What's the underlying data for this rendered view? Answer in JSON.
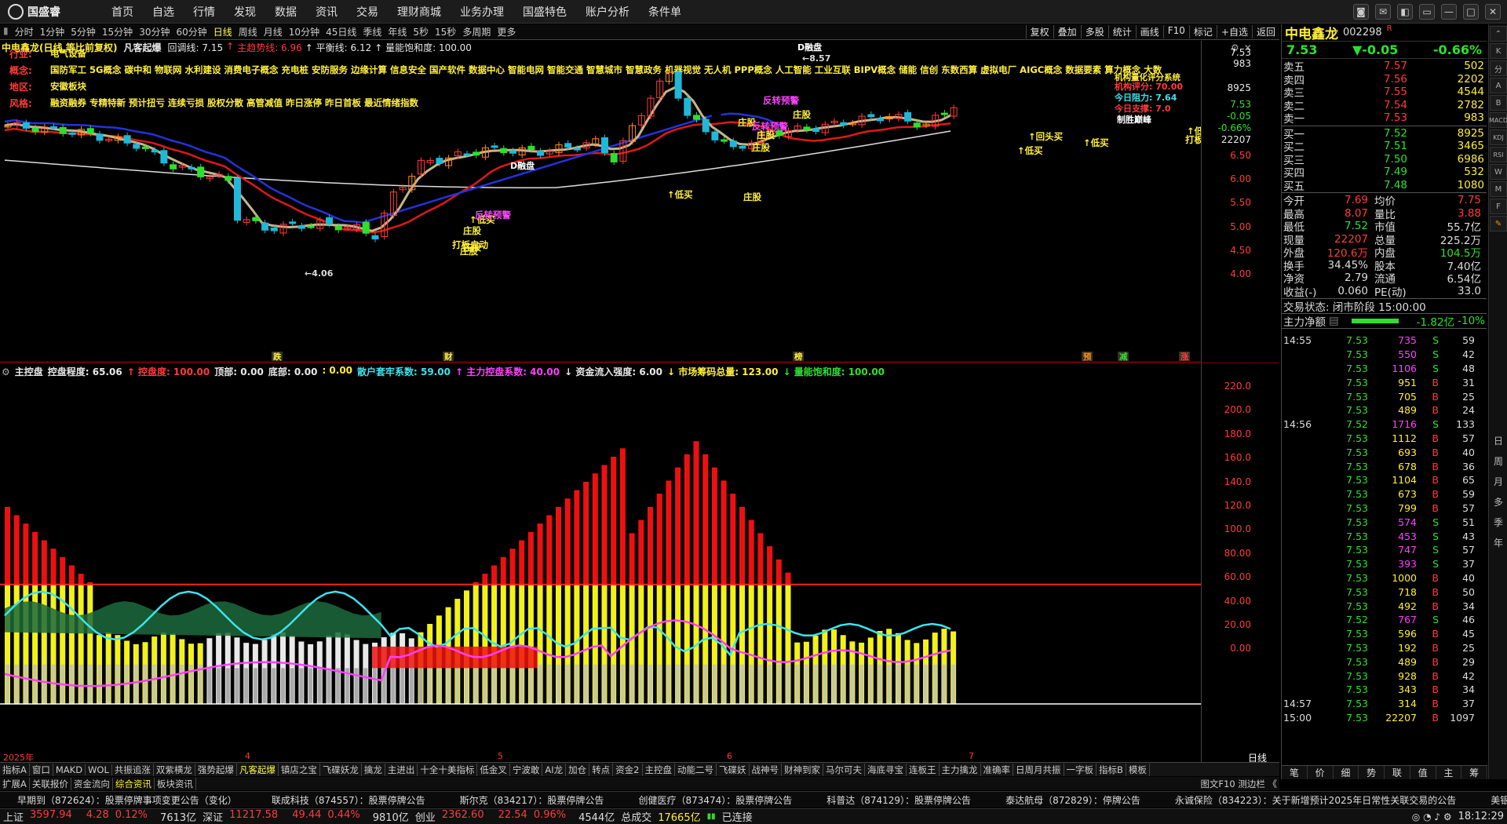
{
  "menubar": {
    "logo": "国盛睿",
    "items": [
      "首页",
      "自选",
      "行情",
      "发现",
      "数据",
      "资讯",
      "交易",
      "理财商城",
      "业务办理",
      "国盛特色",
      "账户分析",
      "条件单"
    ]
  },
  "periodbar": {
    "items": [
      "分时",
      "1分钟",
      "5分钟",
      "15分钟",
      "30分钟",
      "60分钟",
      "日线",
      "周线",
      "月线",
      "10分钟",
      "45日线",
      "季线",
      "年线",
      "5秒",
      "15秒",
      "多周期",
      "更多"
    ],
    "active": "日线",
    "tools": [
      "复权",
      "叠加",
      "多股",
      "统计",
      "画线",
      "F10",
      "标记",
      "+自选",
      "返回"
    ]
  },
  "main": {
    "title": "中电鑫龙(日线,等比前复权)",
    "indicator": "凡客起爆",
    "params": [
      {
        "text": "回调线: 7.15",
        "color": "#e8e8e8"
      },
      {
        "text": "↑ ",
        "color": "#ff3b3b"
      },
      {
        "text": "主趋势线: 6.96",
        "color": "#ff3b3b"
      },
      {
        "text": "↑ 平衡线: 6.12",
        "color": "#e8e8e8"
      },
      {
        "text": "↑ 量能饱和度: 100.00",
        "color": "#e8e8e8"
      }
    ],
    "info": [
      {
        "key": "行业:",
        "val": "电气设备"
      },
      {
        "key": "概念:",
        "val": "国防军工 5G概念 碳中和 物联网 水利建设 消费电子概念 充电桩 安防服务 边缘计算 信息安全 国产软件 数据中心 智能电网 智能交通 智慧城市 智慧政务 机器视觉 无人机 PPP概念 人工智能 工业互联 BIPV概念 储能 信创 东数西算 虚拟电厂 AIGC概念 数据要素 算力概念 大数"
      },
      {
        "key": "地区:",
        "val": "安徽板块"
      },
      {
        "key": "风格:",
        "val": "融资融券 专精特新 预计扭亏 连续亏损 股权分散 高管减值 昨日涨停 昨日首板 最近情绪指数"
      }
    ],
    "y_ticks": [
      "7.53",
      "983",
      "8925",
      "7.53",
      "-0.05",
      "-0.66%",
      "22207",
      "6.50",
      "6.00",
      "5.50",
      "5.00",
      "4.50",
      "4.00"
    ],
    "annotations": {
      "high": "8.57",
      "low": "4.06",
      "top_label": "D融盘",
      "mid_label": "D融盘",
      "box": [
        "机构评分: 70.00",
        "今日阻力: 7.64",
        "今日支撑: 7.0",
        "制胜巅峰"
      ],
      "tags": [
        "庄股",
        "庄股",
        "庄股",
        "庄股",
        "庄股",
        "庄股",
        "庄股",
        "庄股",
        "低买",
        "低买",
        "低买",
        "低买",
        "低买",
        "打板启动",
        "打板启动",
        "反转预警",
        "反转预警",
        "反转预警",
        "回头买"
      ],
      "bottom_marks": [
        "跌",
        "财",
        "榜",
        "预",
        "减",
        "涨"
      ]
    }
  },
  "sub": {
    "name": "主控盘",
    "params": [
      {
        "text": "控盘程度: 65.06",
        "color": "#e8e8e8"
      },
      {
        "text": "↑ 控盘度: 100.00",
        "color": "#ff3b3b"
      },
      {
        "text": "顶部: 0.00",
        "color": "#e8e8e8"
      },
      {
        "text": "底部: 0.00",
        "color": "#e8e8e8"
      },
      {
        "text": ": 0.00",
        "color": "#ffef3b"
      },
      {
        "text": "散户套牢系数: 59.00",
        "color": "#3ee3ee"
      },
      {
        "text": "↑ 主力控盘系数: 40.00",
        "color": "#ff40ff"
      },
      {
        "text": "↓ 资金流入强度: 6.00",
        "color": "#e8e8e8"
      },
      {
        "text": "↓ 市场筹码总量: 123.00",
        "color": "#ffef3b"
      },
      {
        "text": "↓ 量能饱和度: 100.00",
        "color": "#2ee02e"
      }
    ],
    "y_ticks": [
      "220.0",
      "200.0",
      "180.0",
      "160.0",
      "140.0",
      "120.0",
      "100.0",
      "80.00",
      "60.00",
      "40.00",
      "20.00",
      "0.00"
    ],
    "x_ticks": [
      "2025年",
      "4",
      "5",
      "6",
      "7"
    ],
    "period_label": "日线"
  },
  "quote": {
    "name": "中电鑫龙",
    "code": "002298",
    "flag": "R",
    "price": "7.53",
    "change": "▼-0.05",
    "pct": "-0.66%",
    "asks": [
      {
        "l": "卖五",
        "p": "7.57",
        "v": "502"
      },
      {
        "l": "卖四",
        "p": "7.56",
        "v": "2202"
      },
      {
        "l": "卖三",
        "p": "7.55",
        "v": "4544"
      },
      {
        "l": "卖二",
        "p": "7.54",
        "v": "2782"
      },
      {
        "l": "卖一",
        "p": "7.53",
        "v": "983"
      }
    ],
    "bids": [
      {
        "l": "买一",
        "p": "7.52",
        "v": "8925"
      },
      {
        "l": "买二",
        "p": "7.51",
        "v": "3465"
      },
      {
        "l": "买三",
        "p": "7.50",
        "v": "6986"
      },
      {
        "l": "买四",
        "p": "7.49",
        "v": "532"
      },
      {
        "l": "买五",
        "p": "7.48",
        "v": "1080"
      }
    ],
    "stats": [
      [
        "今开",
        "7.69",
        "均价",
        "7.75"
      ],
      [
        "最高",
        "8.07",
        "量比",
        "3.88"
      ],
      [
        "最低",
        "7.52",
        "市值",
        "55.7亿"
      ],
      [
        "现量",
        "22207",
        "总量",
        "225.2万"
      ],
      [
        "外盘",
        "120.6万",
        "内盘",
        "104.5万"
      ],
      [
        "换手",
        "34.45%",
        "股本",
        "7.40亿"
      ],
      [
        "净资",
        "2.79",
        "流通",
        "6.54亿"
      ],
      [
        "收益(-)",
        "0.060",
        "PE(动)",
        "33.0"
      ]
    ],
    "trade_status": "交易状态: 闭市阶段 15:00:00",
    "net_label": "主力净额",
    "net_value": "-1.82亿",
    "net_pct": "-10%"
  },
  "ticks": [
    {
      "t": "14:55",
      "p": "7.53",
      "v": "735",
      "s": "S",
      "n": "59"
    },
    {
      "t": "",
      "p": "7.53",
      "v": "550",
      "s": "S",
      "n": "42"
    },
    {
      "t": "",
      "p": "7.53",
      "v": "1106",
      "s": "S",
      "n": "48"
    },
    {
      "t": "",
      "p": "7.53",
      "v": "951",
      "s": "B",
      "n": "31"
    },
    {
      "t": "",
      "p": "7.53",
      "v": "705",
      "s": "B",
      "n": "25"
    },
    {
      "t": "",
      "p": "7.53",
      "v": "489",
      "s": "B",
      "n": "24"
    },
    {
      "t": "14:56",
      "p": "7.52",
      "v": "1716",
      "s": "S",
      "n": "133"
    },
    {
      "t": "",
      "p": "7.53",
      "v": "1112",
      "s": "B",
      "n": "57"
    },
    {
      "t": "",
      "p": "7.53",
      "v": "693",
      "s": "B",
      "n": "40"
    },
    {
      "t": "",
      "p": "7.53",
      "v": "678",
      "s": "B",
      "n": "36"
    },
    {
      "t": "",
      "p": "7.53",
      "v": "1104",
      "s": "B",
      "n": "65"
    },
    {
      "t": "",
      "p": "7.53",
      "v": "673",
      "s": "B",
      "n": "59"
    },
    {
      "t": "",
      "p": "7.53",
      "v": "799",
      "s": "B",
      "n": "57"
    },
    {
      "t": "",
      "p": "7.53",
      "v": "574",
      "s": "S",
      "n": "51"
    },
    {
      "t": "",
      "p": "7.53",
      "v": "453",
      "s": "S",
      "n": "43"
    },
    {
      "t": "",
      "p": "7.53",
      "v": "747",
      "s": "S",
      "n": "57"
    },
    {
      "t": "",
      "p": "7.53",
      "v": "393",
      "s": "S",
      "n": "37"
    },
    {
      "t": "",
      "p": "7.53",
      "v": "1000",
      "s": "B",
      "n": "40"
    },
    {
      "t": "",
      "p": "7.53",
      "v": "718",
      "s": "B",
      "n": "50"
    },
    {
      "t": "",
      "p": "7.53",
      "v": "492",
      "s": "B",
      "n": "34"
    },
    {
      "t": "",
      "p": "7.52",
      "v": "767",
      "s": "S",
      "n": "46"
    },
    {
      "t": "",
      "p": "7.53",
      "v": "596",
      "s": "B",
      "n": "45"
    },
    {
      "t": "",
      "p": "7.53",
      "v": "192",
      "s": "B",
      "n": "25"
    },
    {
      "t": "",
      "p": "7.53",
      "v": "489",
      "s": "B",
      "n": "29"
    },
    {
      "t": "",
      "p": "7.53",
      "v": "928",
      "s": "B",
      "n": "42"
    },
    {
      "t": "",
      "p": "7.53",
      "v": "343",
      "s": "B",
      "n": "34"
    },
    {
      "t": "14:57",
      "p": "7.53",
      "v": "314",
      "s": "B",
      "n": "37"
    },
    {
      "t": "15:00",
      "p": "7.53",
      "v": "22207",
      "s": "B",
      "n": "1097"
    }
  ],
  "right_bottom_tabs": [
    "笔",
    "价",
    "细",
    "势",
    "联",
    "值",
    "主",
    "筹"
  ],
  "side_tabs": [
    "K",
    "分",
    "A",
    "B",
    "MACD",
    "KDJ",
    "RSI",
    "W",
    "M",
    "F"
  ],
  "side_text": [
    "日",
    "周",
    "月",
    "多",
    "季",
    "年"
  ],
  "bottom_tabs": [
    "指标A",
    "窗口",
    "MAKD",
    "WOL",
    "共振追涨",
    "双紫横龙",
    "强势起爆",
    "凡客起爆",
    "镇店之宝",
    "飞碟妖龙",
    "擒龙",
    "主进出",
    "十全十美指标",
    "低金叉",
    "宁波敢",
    "AI龙",
    "加仓",
    "转点",
    "资金2",
    "主控盘",
    "动能二号",
    "飞碟妖",
    "战神号",
    "财神到家",
    "马尔可夫",
    "海底寻宝",
    "连板王",
    "主力擒龙",
    "准确率",
    "日周月共振",
    "一字板",
    "指标B",
    "模板"
  ],
  "bottom_active": "凡客起爆",
  "bottom_tabs2": [
    "扩展A",
    "关联报价",
    "资金流向",
    "综合资讯",
    "板块资讯"
  ],
  "bottom_tabs2_right": "图文F10 测边栏 《",
  "news": [
    "早期到（872624）：股票停牌事项变更公告（变化）",
    "联成科技（874557）：股票停牌公告",
    "斯尔克（834217）：股票停牌公告",
    "创健医疗（873474）：股票停牌公告",
    "科普达（874129）：股票停牌公告",
    "泰达航母（872829）：停牌公告",
    "永诚保险（834223）：关于新增预计2025年日常性关联交易的公告",
    "美银前"
  ],
  "status": {
    "items": [
      {
        "k": "上证",
        "v": "3597.94",
        "c": "4.28",
        "p": "0.12%",
        "a": "7613亿"
      },
      {
        "k": "深证",
        "v": "11217.58",
        "c": "49.44",
        "p": "0.44%",
        "a": "9810亿"
      },
      {
        "k": "创业",
        "v": "2362.60",
        "c": "22.54",
        "p": "0.96%",
        "a": "4544亿"
      }
    ],
    "total_label": "总成交",
    "total": "17665亿",
    "conn": "已连接",
    "time": "18:12:29"
  },
  "colors": {
    "up": "#ff3b3b",
    "down": "#2ee02e",
    "text": "#e8e8e8",
    "yellow": "#ffef3b"
  }
}
